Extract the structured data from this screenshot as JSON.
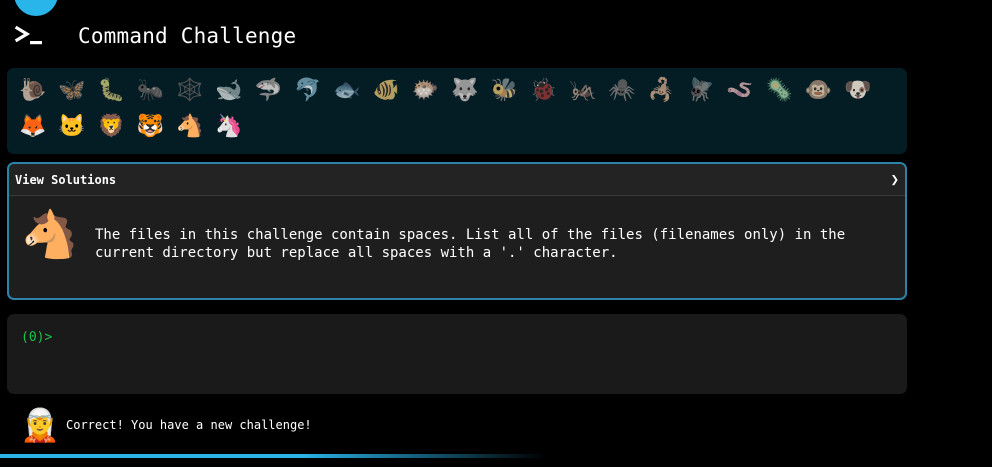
{
  "app": {
    "title": "Command Challenge"
  },
  "animals": [
    {
      "icon": "snail-icon",
      "glyph": "🐌"
    },
    {
      "icon": "butterfly-icon",
      "glyph": "🦋"
    },
    {
      "icon": "caterpillar-icon",
      "glyph": "🐛"
    },
    {
      "icon": "ant-icon",
      "glyph": "🐜"
    },
    {
      "icon": "spider-web-icon",
      "glyph": "🕸️"
    },
    {
      "icon": "whale-icon",
      "glyph": "🐋"
    },
    {
      "icon": "shark-icon",
      "glyph": "🦈"
    },
    {
      "icon": "dolphin-icon",
      "glyph": "🐬"
    },
    {
      "icon": "fish-icon",
      "glyph": "🐟"
    },
    {
      "icon": "tropical-fish-icon",
      "glyph": "🐠"
    },
    {
      "icon": "blowfish-icon",
      "glyph": "🐡"
    },
    {
      "icon": "wolf-icon",
      "glyph": "🐺"
    },
    {
      "icon": "bee-icon",
      "glyph": "🐝"
    },
    {
      "icon": "ladybug-icon",
      "glyph": "🐞"
    },
    {
      "icon": "cricket-icon",
      "glyph": "🦗"
    },
    {
      "icon": "spider-icon",
      "glyph": "🕷️"
    },
    {
      "icon": "scorpion-icon",
      "glyph": "🦂"
    },
    {
      "icon": "fly-icon",
      "glyph": "🪰"
    },
    {
      "icon": "worm-icon",
      "glyph": "🪱"
    },
    {
      "icon": "microbe-icon",
      "glyph": "🦠"
    },
    {
      "icon": "monkey-icon",
      "glyph": "🐵"
    },
    {
      "icon": "dog-icon",
      "glyph": "🐶"
    },
    {
      "icon": "fox-icon",
      "glyph": "🦊"
    },
    {
      "icon": "cat-icon",
      "glyph": "🐱"
    },
    {
      "icon": "lion-icon",
      "glyph": "🦁"
    },
    {
      "icon": "tiger-icon",
      "glyph": "🐯"
    },
    {
      "icon": "horse-icon",
      "glyph": "🐴"
    },
    {
      "icon": "unicorn-icon",
      "glyph": "🦄"
    }
  ],
  "solutions": {
    "label": "View Solutions",
    "chevron": "❯"
  },
  "challenge": {
    "icon": "horse-icon",
    "glyph": "🐴",
    "text": "The files in this challenge contain spaces. List all of the files (filenames only) in the\ncurrent directory but replace all spaces with a '.' character."
  },
  "terminal": {
    "prompt": "(0)>",
    "value": ""
  },
  "status": {
    "avatar_icon": "elf-icon",
    "avatar_glyph": "🧝",
    "message": "Correct! You have a new challenge!"
  },
  "progress": {
    "value": 0.55
  },
  "colors": {
    "accent": "#29b4ea",
    "prompt": "#19c44a",
    "panel": "#041c24",
    "card_border": "#2b83a8"
  }
}
